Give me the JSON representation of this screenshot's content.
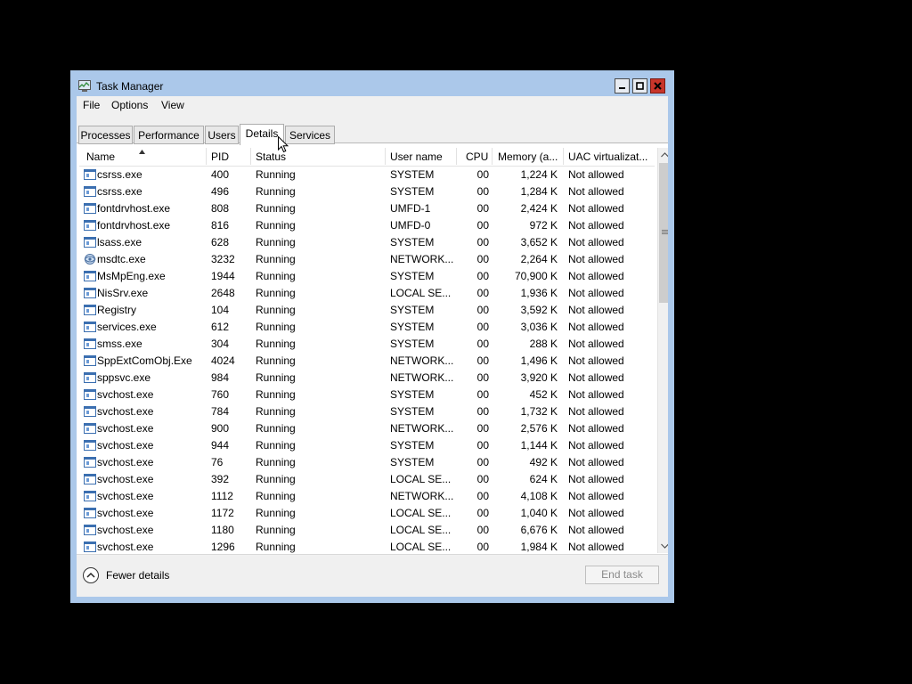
{
  "window": {
    "title": "Task Manager"
  },
  "menu": [
    "File",
    "Options",
    "View"
  ],
  "tabs": [
    {
      "label": "Processes"
    },
    {
      "label": "Performance"
    },
    {
      "label": "Users"
    },
    {
      "label": "Details",
      "active": true
    },
    {
      "label": "Services"
    }
  ],
  "columns": [
    "Name",
    "PID",
    "Status",
    "User name",
    "CPU",
    "Memory (a...",
    "UAC virtualizat..."
  ],
  "sort": {
    "column": "Name",
    "direction": "ascending"
  },
  "rows": [
    {
      "icon": "process-icon",
      "name": "csrss.exe",
      "pid": "400",
      "status": "Running",
      "user": "SYSTEM",
      "cpu": "00",
      "memory": "1,224 K",
      "uac": "Not allowed"
    },
    {
      "icon": "process-icon",
      "name": "csrss.exe",
      "pid": "496",
      "status": "Running",
      "user": "SYSTEM",
      "cpu": "00",
      "memory": "1,284 K",
      "uac": "Not allowed"
    },
    {
      "icon": "process-icon",
      "name": "fontdrvhost.exe",
      "pid": "808",
      "status": "Running",
      "user": "UMFD-1",
      "cpu": "00",
      "memory": "2,424 K",
      "uac": "Not allowed"
    },
    {
      "icon": "process-icon",
      "name": "fontdrvhost.exe",
      "pid": "816",
      "status": "Running",
      "user": "UMFD-0",
      "cpu": "00",
      "memory": "972 K",
      "uac": "Not allowed"
    },
    {
      "icon": "process-icon",
      "name": "lsass.exe",
      "pid": "628",
      "status": "Running",
      "user": "SYSTEM",
      "cpu": "00",
      "memory": "3,652 K",
      "uac": "Not allowed"
    },
    {
      "icon": "msdtc-icon",
      "name": "msdtc.exe",
      "pid": "3232",
      "status": "Running",
      "user": "NETWORK...",
      "cpu": "00",
      "memory": "2,264 K",
      "uac": "Not allowed"
    },
    {
      "icon": "process-icon",
      "name": "MsMpEng.exe",
      "pid": "1944",
      "status": "Running",
      "user": "SYSTEM",
      "cpu": "00",
      "memory": "70,900 K",
      "uac": "Not allowed"
    },
    {
      "icon": "process-icon",
      "name": "NisSrv.exe",
      "pid": "2648",
      "status": "Running",
      "user": "LOCAL SE...",
      "cpu": "00",
      "memory": "1,936 K",
      "uac": "Not allowed"
    },
    {
      "icon": "process-icon",
      "name": "Registry",
      "pid": "104",
      "status": "Running",
      "user": "SYSTEM",
      "cpu": "00",
      "memory": "3,592 K",
      "uac": "Not allowed"
    },
    {
      "icon": "process-icon",
      "name": "services.exe",
      "pid": "612",
      "status": "Running",
      "user": "SYSTEM",
      "cpu": "00",
      "memory": "3,036 K",
      "uac": "Not allowed"
    },
    {
      "icon": "process-icon",
      "name": "smss.exe",
      "pid": "304",
      "status": "Running",
      "user": "SYSTEM",
      "cpu": "00",
      "memory": "288 K",
      "uac": "Not allowed"
    },
    {
      "icon": "process-icon",
      "name": "SppExtComObj.Exe",
      "pid": "4024",
      "status": "Running",
      "user": "NETWORK...",
      "cpu": "00",
      "memory": "1,496 K",
      "uac": "Not allowed"
    },
    {
      "icon": "process-icon",
      "name": "sppsvc.exe",
      "pid": "984",
      "status": "Running",
      "user": "NETWORK...",
      "cpu": "00",
      "memory": "3,920 K",
      "uac": "Not allowed"
    },
    {
      "icon": "process-icon",
      "name": "svchost.exe",
      "pid": "760",
      "status": "Running",
      "user": "SYSTEM",
      "cpu": "00",
      "memory": "452 K",
      "uac": "Not allowed"
    },
    {
      "icon": "process-icon",
      "name": "svchost.exe",
      "pid": "784",
      "status": "Running",
      "user": "SYSTEM",
      "cpu": "00",
      "memory": "1,732 K",
      "uac": "Not allowed"
    },
    {
      "icon": "process-icon",
      "name": "svchost.exe",
      "pid": "900",
      "status": "Running",
      "user": "NETWORK...",
      "cpu": "00",
      "memory": "2,576 K",
      "uac": "Not allowed"
    },
    {
      "icon": "process-icon",
      "name": "svchost.exe",
      "pid": "944",
      "status": "Running",
      "user": "SYSTEM",
      "cpu": "00",
      "memory": "1,144 K",
      "uac": "Not allowed"
    },
    {
      "icon": "process-icon",
      "name": "svchost.exe",
      "pid": "76",
      "status": "Running",
      "user": "SYSTEM",
      "cpu": "00",
      "memory": "492 K",
      "uac": "Not allowed"
    },
    {
      "icon": "process-icon",
      "name": "svchost.exe",
      "pid": "392",
      "status": "Running",
      "user": "LOCAL SE...",
      "cpu": "00",
      "memory": "624 K",
      "uac": "Not allowed"
    },
    {
      "icon": "process-icon",
      "name": "svchost.exe",
      "pid": "1112",
      "status": "Running",
      "user": "NETWORK...",
      "cpu": "00",
      "memory": "4,108 K",
      "uac": "Not allowed"
    },
    {
      "icon": "process-icon",
      "name": "svchost.exe",
      "pid": "1172",
      "status": "Running",
      "user": "LOCAL SE...",
      "cpu": "00",
      "memory": "1,040 K",
      "uac": "Not allowed"
    },
    {
      "icon": "process-icon",
      "name": "svchost.exe",
      "pid": "1180",
      "status": "Running",
      "user": "LOCAL SE...",
      "cpu": "00",
      "memory": "6,676 K",
      "uac": "Not allowed"
    },
    {
      "icon": "process-icon",
      "name": "svchost.exe",
      "pid": "1296",
      "status": "Running",
      "user": "LOCAL SE...",
      "cpu": "00",
      "memory": "1,984 K",
      "uac": "Not allowed"
    }
  ],
  "footer": {
    "fewer_details": "Fewer details",
    "end_task": "End task",
    "end_task_enabled": false
  },
  "colors": {
    "frame": "#abc8ea",
    "close_button": "#c8352a",
    "background": "#000000"
  }
}
